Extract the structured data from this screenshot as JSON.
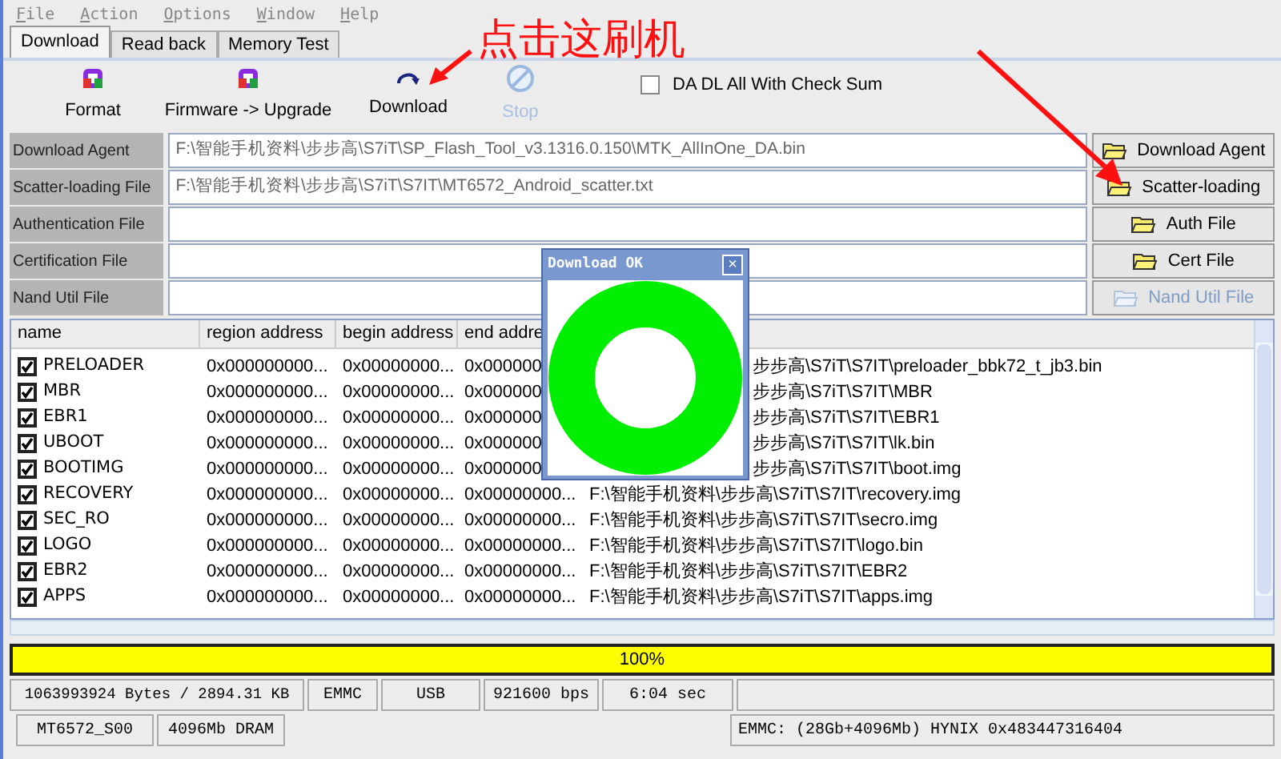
{
  "menu": [
    "File",
    "Action",
    "Options",
    "Window",
    "Help"
  ],
  "tabs": [
    {
      "label": "Download",
      "selected": true
    },
    {
      "label": "Read back",
      "selected": false
    },
    {
      "label": "Memory Test",
      "selected": false
    }
  ],
  "toolbar": [
    {
      "label": "Format",
      "kind": "format",
      "disabled": false
    },
    {
      "label": "Firmware -> Upgrade",
      "kind": "upgrade",
      "disabled": false
    },
    {
      "label": "Download",
      "kind": "download",
      "disabled": false
    },
    {
      "label": "Stop",
      "kind": "stop",
      "disabled": true
    }
  ],
  "checksum": {
    "label": "DA DL All With Check Sum",
    "checked": false
  },
  "files": [
    {
      "label": "Download Agent",
      "value": "F:\\智能手机资料\\步步高\\S7iT\\SP_Flash_Tool_v3.1316.0.150\\MTK_AllInOne_DA.bin",
      "button": "Download Agent",
      "disabled": false
    },
    {
      "label": "Scatter-loading File",
      "value": "F:\\智能手机资料\\步步高\\S7iT\\S7IT\\MT6572_Android_scatter.txt",
      "button": "Scatter-loading",
      "disabled": false
    },
    {
      "label": "Authentication File",
      "button": "Auth File",
      "disabled": false
    },
    {
      "label": "Certification File",
      "button": "Cert File",
      "disabled": false
    },
    {
      "label": "Nand Util File",
      "button": "Nand Util File",
      "disabled": true
    }
  ],
  "table": {
    "columns": [
      "name",
      "region address",
      "begin address",
      "end addre"
    ],
    "rows": [
      {
        "name": "PRELOADER",
        "checked": true,
        "region": "0x000000000...",
        "begin": "0x00000000...",
        "end": "0x000000",
        "location": "步步高\\S7iT\\S7IT\\preloader_bbk72_t_jb3.bin",
        "kind": "covered"
      },
      {
        "name": "MBR",
        "checked": true,
        "region": "0x000000000...",
        "begin": "0x00000000...",
        "end": "0x000000",
        "location": "步步高\\S7iT\\S7IT\\MBR",
        "kind": "covered"
      },
      {
        "name": "EBR1",
        "checked": true,
        "region": "0x000000000...",
        "begin": "0x00000000...",
        "end": "0x000000",
        "location": "步步高\\S7iT\\S7IT\\EBR1",
        "kind": "covered"
      },
      {
        "name": "UBOOT",
        "checked": true,
        "region": "0x000000000...",
        "begin": "0x00000000...",
        "end": "0x000000",
        "location": "步步高\\S7iT\\S7IT\\lk.bin",
        "kind": "covered"
      },
      {
        "name": "BOOTIMG",
        "checked": true,
        "region": "0x000000000...",
        "begin": "0x00000000...",
        "end": "0x000000",
        "location": "步步高\\S7iT\\S7IT\\boot.img",
        "kind": "covered"
      },
      {
        "name": "RECOVERY",
        "checked": true,
        "region": "0x000000000...",
        "begin": "0x00000000...",
        "end": "0x00000000...",
        "location": "F:\\智能手机资料\\步步高\\S7iT\\S7IT\\recovery.img",
        "kind": "full"
      },
      {
        "name": "SEC_RO",
        "checked": true,
        "region": "0x000000000...",
        "begin": "0x00000000...",
        "end": "0x00000000...",
        "location": "F:\\智能手机资料\\步步高\\S7iT\\S7IT\\secro.img",
        "kind": "full"
      },
      {
        "name": "LOGO",
        "checked": true,
        "region": "0x000000000...",
        "begin": "0x00000000...",
        "end": "0x00000000...",
        "location": "F:\\智能手机资料\\步步高\\S7iT\\S7IT\\logo.bin",
        "kind": "full"
      },
      {
        "name": "EBR2",
        "checked": true,
        "region": "0x000000000...",
        "begin": "0x00000000...",
        "end": "0x00000000...",
        "location": "F:\\智能手机资料\\步步高\\S7iT\\S7IT\\EBR2",
        "kind": "full"
      },
      {
        "name": "APPS",
        "checked": true,
        "region": "0x000000000...",
        "begin": "0x00000000...",
        "end": "0x00000000...",
        "location": "F:\\智能手机资料\\步步高\\S7iT\\S7IT\\apps.img",
        "kind": "full"
      }
    ]
  },
  "dialog": {
    "title": "Download OK",
    "close": "×"
  },
  "progress": {
    "level": 1,
    "label": "100%"
  },
  "status_bar": {
    "row_1": [
      "1063993924 Bytes / 2894.31 KB",
      "EMMC",
      "USB",
      "921600 bps",
      "6:04 sec"
    ],
    "row_2": [
      "MT6572_S00",
      "4096Mb DRAM",
      "EMMC: (28Gb+4096Mb) HYNIX 0x483447316404"
    ]
  },
  "annotation": {
    "text": "点击这刷机"
  }
}
